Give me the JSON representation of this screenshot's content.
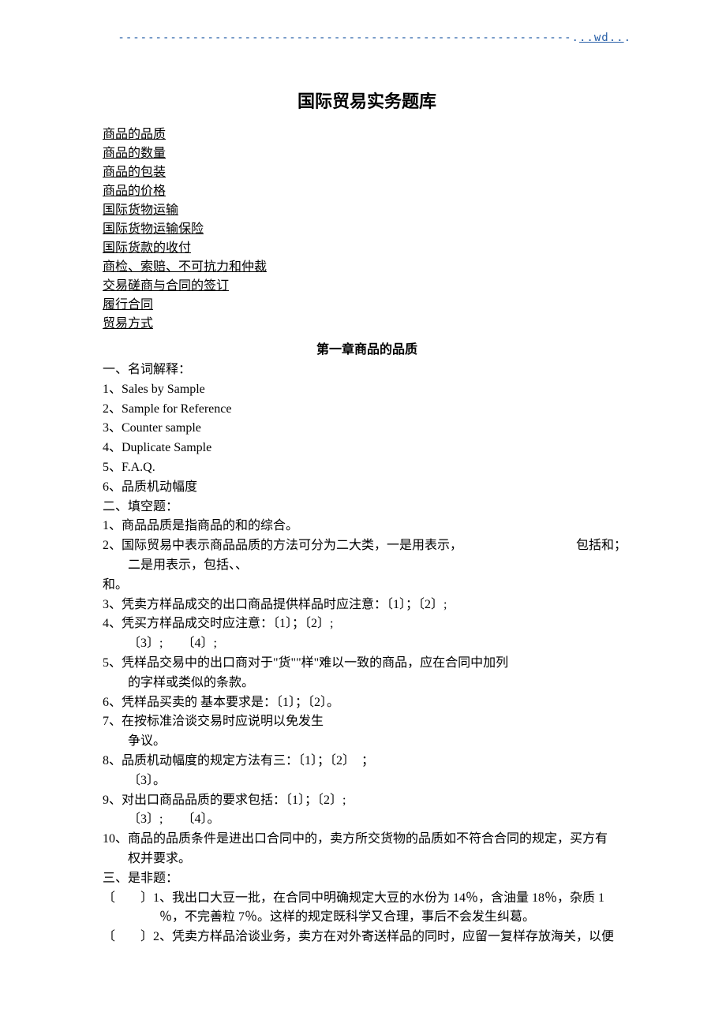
{
  "header": {
    "wd": "..wd.."
  },
  "title": "国际贸易实务题库",
  "toc": [
    "商品的品质",
    "商品的数量",
    "商品的包装",
    "商品的价格",
    "国际货物运输",
    "国际货物运输保险",
    "国际货款的收付",
    "商检、索赔、不可抗力和仲裁",
    "交易磋商与合同的签订",
    "履行合同",
    "贸易方式"
  ],
  "chapter1": "第一章商品的品质",
  "sec1_h": "一、名词解释：",
  "sec1": [
    "1、Sales by Sample",
    "2、Sample for Reference",
    "3、Counter sample",
    "4、Duplicate Sample",
    "5、F.A.Q.",
    "6、品质机动幅度"
  ],
  "sec2_h": "二、填空题：",
  "sec2": {
    "q1": "1、商品品质是指商品的和的综合。",
    "q2a": "2、国际贸易中表示商品品质的方法可分为二大类，一是用表示，",
    "q2b": "包括和；",
    "q2c": "二是用表示，包括、、",
    "q2d": "和。",
    "q3": "3、凭卖方样品成交的出口商品提供样品时应注意：〔1〕；〔2〕;",
    "q4a": "4、凭买方样品成交时应注意：〔1〕；〔2〕;",
    "q4b": "〔3〕;　　〔4〕;",
    "q5a": "5、凭样品交易中的出口商对于\"货\"\"样\"难以一致的商品，应在合同中加列",
    "q5b": "的字样或类似的条款。",
    "q6": "6、凭样品买卖的  基本要求是：〔1〕；〔2〕。",
    "q7a": "7、在按标准洽谈交易时应说明以免发生",
    "q7b": "争议。",
    "q8a": "8、品质机动幅度的规定方法有三：〔1〕；〔2〕　；",
    "q8b": "〔3〕。",
    "q9a": "9、对出口商品品质的要求包括：〔1〕；〔2〕;",
    "q9b": "〔3〕;　　〔4〕。",
    "q10a": "10、商品的品质条件是进出口合同中的，卖方所交货物的品质如不符合合同的规定，买方有",
    "q10b": "权并要求。"
  },
  "sec3_h": "三、是非题：",
  "sec3": {
    "tf1a": "〔　　〕1、我出口大豆一批，在合同中明确规定大豆的水份为 14％，含油量 18％，杂质 1",
    "tf1b": "％，不完善粒 7％。这样的规定既科学又合理，事后不会发生纠葛。",
    "tf2a": "〔　　〕2、凭卖方样品洽谈业务，卖方在对外寄送样品的同时，应留一复样存放海关，以便"
  }
}
